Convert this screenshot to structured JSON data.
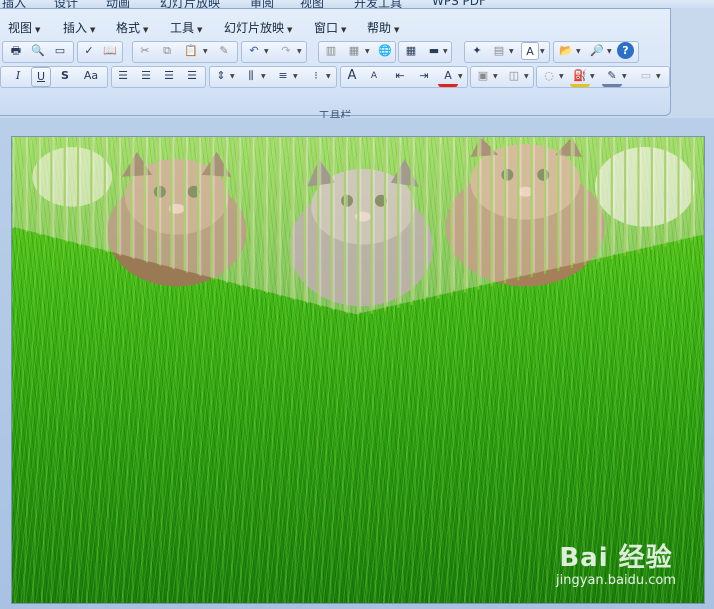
{
  "ribbon_tabs": [
    "插入",
    "设计",
    "动画",
    "幻灯片放映",
    "审阅",
    "视图",
    "开发工具",
    "WPS PDF"
  ],
  "menubar": [
    {
      "label": "视图"
    },
    {
      "label": "插入"
    },
    {
      "label": "格式"
    },
    {
      "label": "工具"
    },
    {
      "label": "幻灯片放映"
    },
    {
      "label": "窗口"
    },
    {
      "label": "帮助"
    }
  ],
  "toolbar_caption": "工具栏",
  "toolbar_row2_labels": {
    "italic": "I",
    "underline": "U",
    "shadow": "S",
    "change_case": "Aa",
    "grow_font": "A",
    "shrink_font": "A",
    "font_color": "A",
    "textbox": "A"
  },
  "watermark": {
    "brand": "Bai 经验",
    "url": "jingyan.baidu.com"
  },
  "colors": {
    "toolbar_bg": "#d6e4f6",
    "slide_grass": "#3fb615",
    "accent_border": "#8fa9cf"
  }
}
